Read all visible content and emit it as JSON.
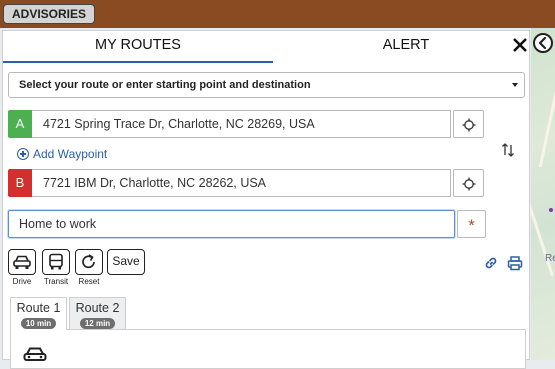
{
  "topbar": {
    "advisories_label": "ADVISORIES"
  },
  "tabs": {
    "routes": "MY ROUTES",
    "alert": "ALERT"
  },
  "route_select": {
    "placeholder": "Select your route or enter starting point and destination"
  },
  "waypoints": [
    {
      "badge": "A",
      "address": "4721 Spring Trace Dr, Charlotte, NC 28269, USA",
      "color": "#4caf50"
    },
    {
      "badge": "B",
      "address": "7721 IBM Dr, Charlotte, NC 28262, USA",
      "color": "#d32f2f"
    }
  ],
  "add_waypoint_label": "Add Waypoint",
  "route_name": {
    "value": "Home to work",
    "required_marker": "*"
  },
  "modes": {
    "drive": "Drive",
    "transit": "Transit",
    "reset": "Reset"
  },
  "save_label": "Save",
  "route_tabs": [
    {
      "name": "Route 1",
      "duration": "10 min"
    },
    {
      "name": "Route 2",
      "duration": "12 min"
    }
  ],
  "colors": {
    "accent": "#2b5fa6",
    "topbar": "#8a4a22",
    "required": "#a8502a"
  },
  "icons": [
    "close-icon",
    "collapse-icon",
    "crosshair-icon",
    "swap-icon",
    "car-icon",
    "bus-icon",
    "reset-icon",
    "link-icon",
    "print-icon"
  ]
}
